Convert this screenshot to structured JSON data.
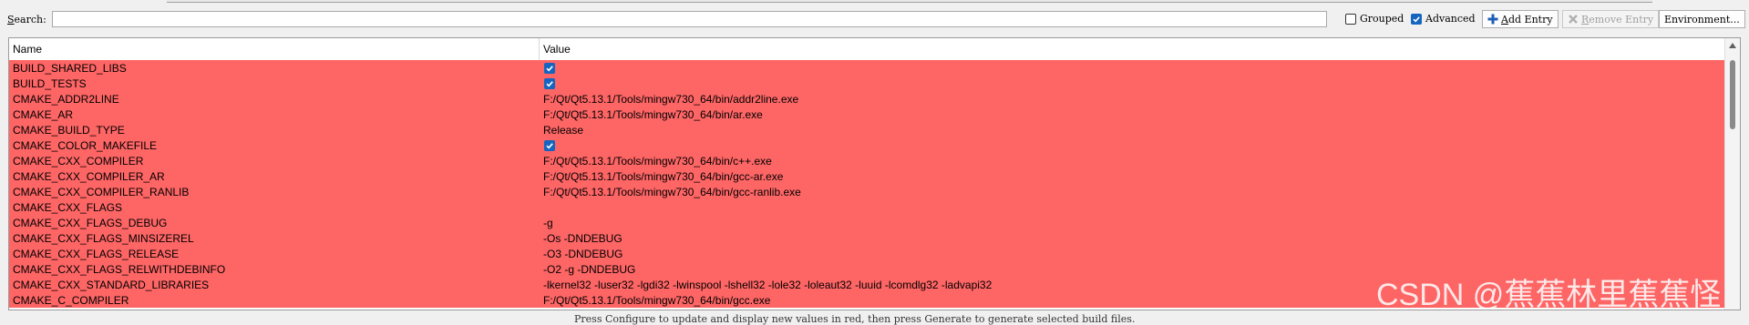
{
  "toolbar": {
    "search_label_key": "S",
    "search_label_rest": "earch:",
    "search_value": "",
    "grouped_label": "Grouped",
    "grouped_checked": false,
    "advanced_label": "Advanced",
    "advanced_checked": true,
    "add_entry_key": "A",
    "add_entry_rest": "dd Entry",
    "remove_entry_key": "R",
    "remove_entry_rest": "emove Entry",
    "environment_label": "Environment..."
  },
  "table": {
    "headers": {
      "name": "Name",
      "value": "Value"
    },
    "row_color": "#fe6565",
    "rows": [
      {
        "name": "BUILD_SHARED_LIBS",
        "type": "bool",
        "value": true
      },
      {
        "name": "BUILD_TESTS",
        "type": "bool",
        "value": true
      },
      {
        "name": "CMAKE_ADDR2LINE",
        "type": "text",
        "value": "F:/Qt/Qt5.13.1/Tools/mingw730_64/bin/addr2line.exe"
      },
      {
        "name": "CMAKE_AR",
        "type": "text",
        "value": "F:/Qt/Qt5.13.1/Tools/mingw730_64/bin/ar.exe"
      },
      {
        "name": "CMAKE_BUILD_TYPE",
        "type": "text",
        "value": "Release"
      },
      {
        "name": "CMAKE_COLOR_MAKEFILE",
        "type": "bool",
        "value": true
      },
      {
        "name": "CMAKE_CXX_COMPILER",
        "type": "text",
        "value": "F:/Qt/Qt5.13.1/Tools/mingw730_64/bin/c++.exe"
      },
      {
        "name": "CMAKE_CXX_COMPILER_AR",
        "type": "text",
        "value": "F:/Qt/Qt5.13.1/Tools/mingw730_64/bin/gcc-ar.exe"
      },
      {
        "name": "CMAKE_CXX_COMPILER_RANLIB",
        "type": "text",
        "value": "F:/Qt/Qt5.13.1/Tools/mingw730_64/bin/gcc-ranlib.exe"
      },
      {
        "name": "CMAKE_CXX_FLAGS",
        "type": "text",
        "value": ""
      },
      {
        "name": "CMAKE_CXX_FLAGS_DEBUG",
        "type": "text",
        "value": "-g"
      },
      {
        "name": "CMAKE_CXX_FLAGS_MINSIZEREL",
        "type": "text",
        "value": "-Os -DNDEBUG"
      },
      {
        "name": "CMAKE_CXX_FLAGS_RELEASE",
        "type": "text",
        "value": "-O3 -DNDEBUG"
      },
      {
        "name": "CMAKE_CXX_FLAGS_RELWITHDEBINFO",
        "type": "text",
        "value": "-O2 -g -DNDEBUG"
      },
      {
        "name": "CMAKE_CXX_STANDARD_LIBRARIES",
        "type": "text",
        "value": "-lkernel32 -luser32 -lgdi32 -lwinspool -lshell32 -lole32 -loleaut32 -luuid -lcomdlg32 -ladvapi32"
      },
      {
        "name": "CMAKE_C_COMPILER",
        "type": "text",
        "value": "F:/Qt/Qt5.13.1/Tools/mingw730_64/bin/gcc.exe"
      }
    ]
  },
  "footer": {
    "hint_text": "Press Configure to update and display new values in red, then press Generate to generate selected build files."
  },
  "watermark": "CSDN @蕉蕉林里蕉蕉怪"
}
